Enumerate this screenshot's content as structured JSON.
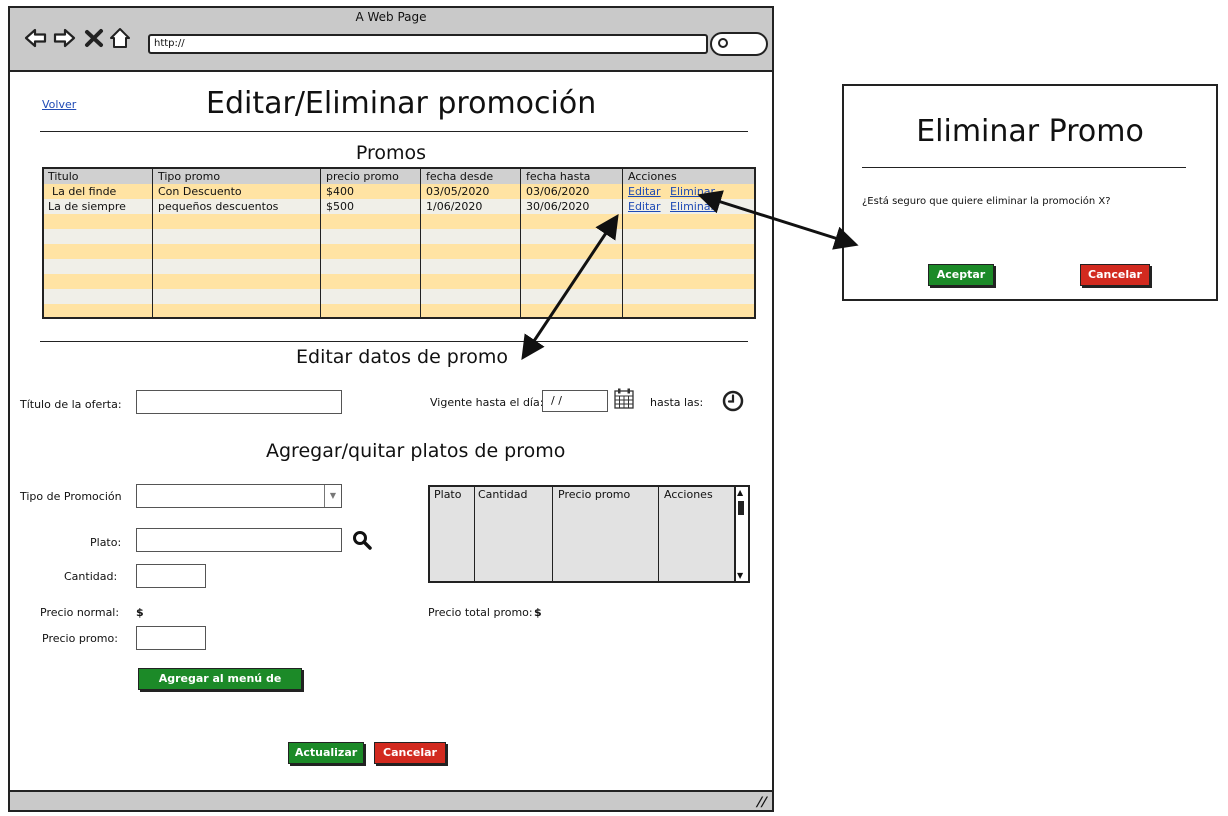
{
  "browser": {
    "title": "A Web Page",
    "url": "http://"
  },
  "page": {
    "back_link": "Volver",
    "title": "Editar/Eliminar promoción",
    "promos_heading": "Promos",
    "edit_heading": "Editar datos de promo",
    "dishes_heading": "Agregar/quitar platos de promo"
  },
  "promos_table": {
    "columns": [
      "Titulo",
      "Tipo promo",
      "precio promo",
      "fecha desde",
      "fecha hasta",
      "Acciones"
    ],
    "rows": [
      {
        "titulo": "La del finde",
        "tipo": "Con Descuento",
        "precio": "$400",
        "desde": "03/05/2020",
        "hasta": "03/06/2020",
        "edit": "Editar",
        "delete": "Eliminar"
      },
      {
        "titulo": "La de siempre",
        "tipo": "pequeños descuentos",
        "precio": "$500",
        "desde": "1/06/2020",
        "hasta": "30/06/2020",
        "edit": "Editar",
        "delete": "Eliminar"
      }
    ]
  },
  "edit_form": {
    "offer_title_label": "Título de la oferta:",
    "offer_title_value": "",
    "valid_until_label": "Vigente hasta el día:",
    "date_value": " /  /",
    "until_time_label": "hasta las:"
  },
  "dishes_form": {
    "promo_type_label": "Tipo de Promoción",
    "promo_type_value": "",
    "dish_label": "Plato:",
    "quantity_label": "Cantidad:",
    "normal_price_label": "Precio normal:",
    "normal_price_value": "$",
    "promo_price_label": "Precio promo:",
    "add_button": "Agregar al menú de promo",
    "total_price_label": "Precio total promo:",
    "total_price_value": "$"
  },
  "dishes_table": {
    "columns": [
      "Plato",
      "Cantidad",
      "Precio promo",
      "Acciones"
    ]
  },
  "footer_buttons": {
    "update": "Actualizar",
    "cancel": "Cancelar"
  },
  "delete_modal": {
    "title": "Eliminar Promo",
    "message": "¿Está seguro que quiere eliminar la promoción X?",
    "accept": "Aceptar",
    "cancel": "Cancelar"
  },
  "colors": {
    "row_stripe": "#ffe3a3",
    "green_button": "#1c8a28",
    "red_button": "#d22a1f",
    "link": "#1f4bb5"
  }
}
